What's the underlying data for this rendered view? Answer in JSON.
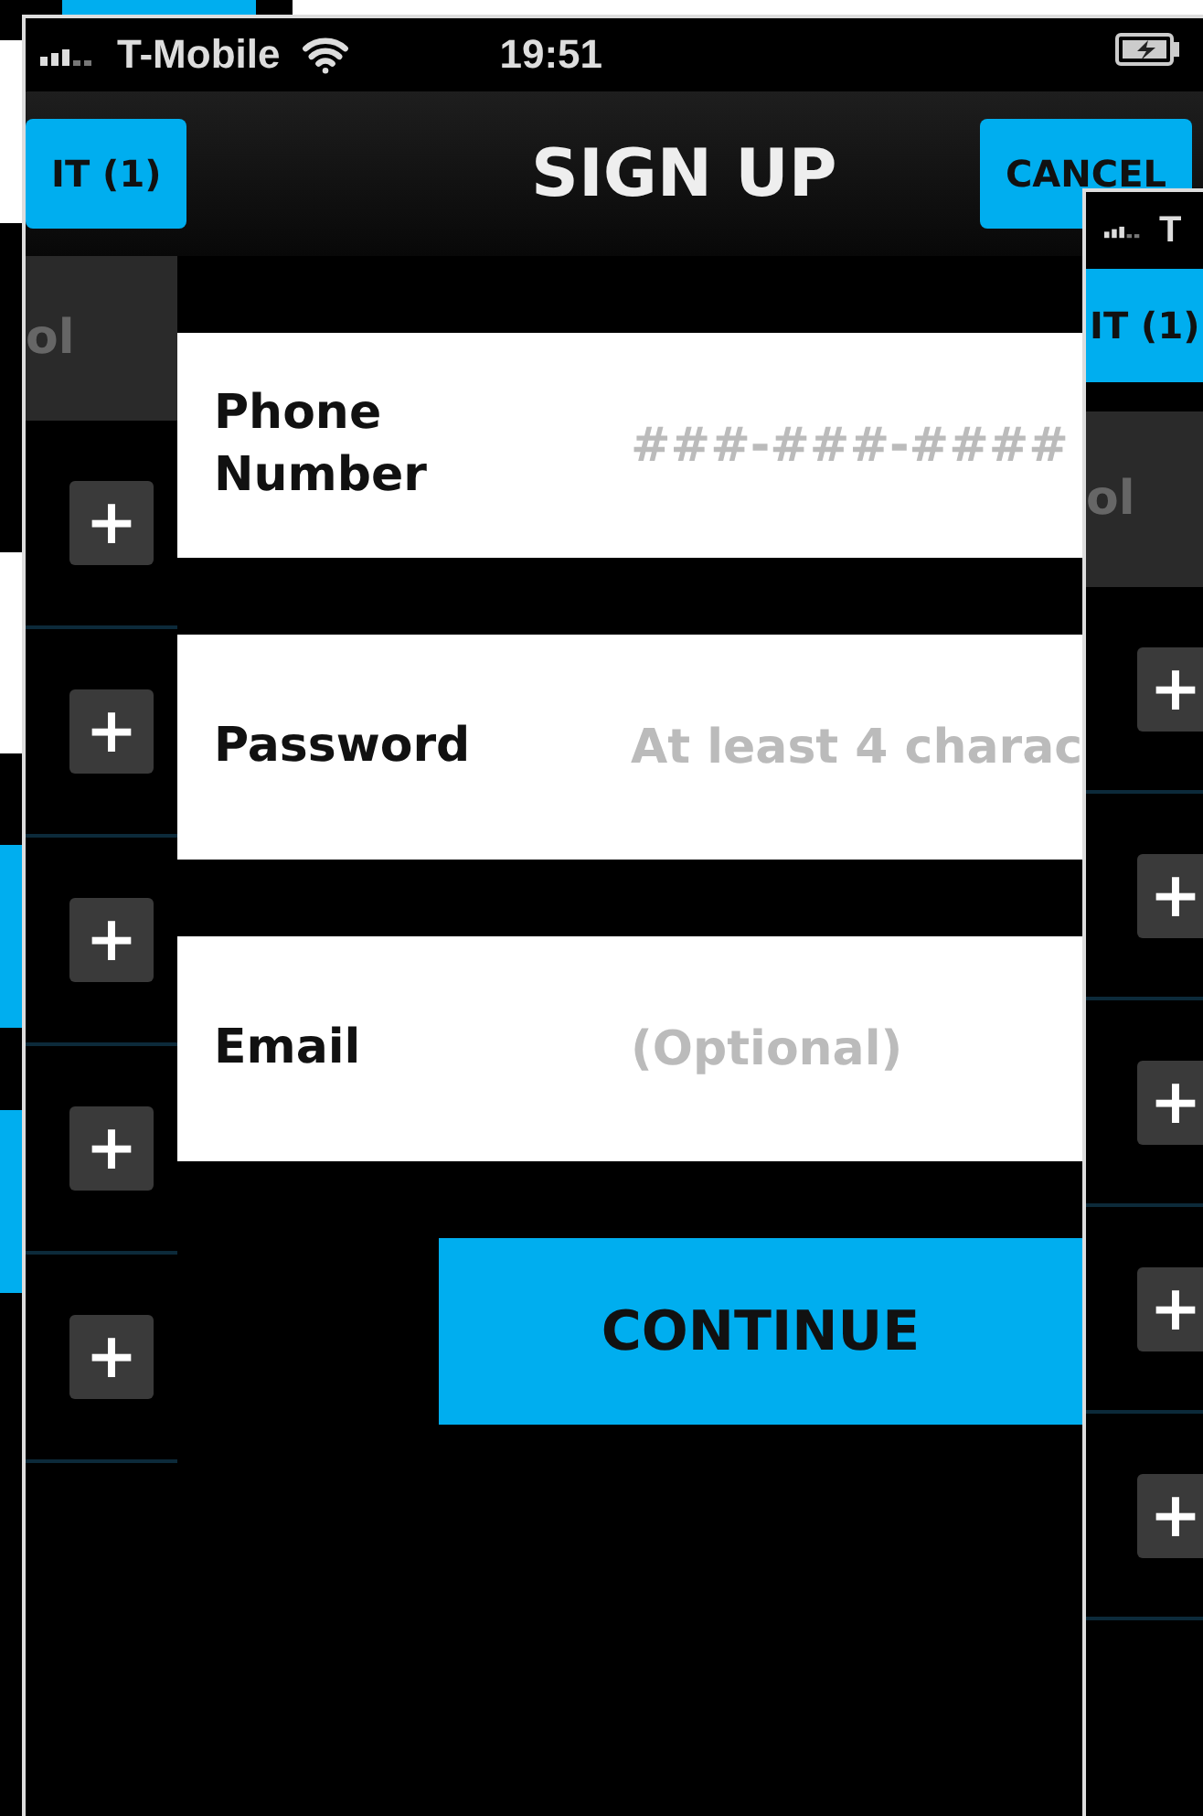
{
  "status_bar": {
    "carrier": "T-Mobile",
    "time": "19:51"
  },
  "nav_bar": {
    "left_button": "IT (1)",
    "title": "SIGN UP",
    "right_button": "CANCEL"
  },
  "list_behind": {
    "header": "ol",
    "rows": [
      {
        "button": "+"
      },
      {
        "button": "+"
      },
      {
        "button": "+"
      },
      {
        "button": "+"
      },
      {
        "button": "+"
      }
    ]
  },
  "form": {
    "fields": [
      {
        "label": "Phone Number",
        "placeholder": "###-###-####"
      },
      {
        "label": "Password",
        "placeholder": "At least 4 charac"
      },
      {
        "label": "Email",
        "placeholder": "(Optional)"
      }
    ],
    "button": "CONTINUE"
  },
  "right_screen": {
    "carrier": "T",
    "left_button": "IT (1)",
    "header": "ol",
    "rows": [
      {
        "button": "+"
      },
      {
        "button": "+"
      },
      {
        "button": "+"
      },
      {
        "button": "+"
      },
      {
        "button": "+"
      }
    ]
  }
}
